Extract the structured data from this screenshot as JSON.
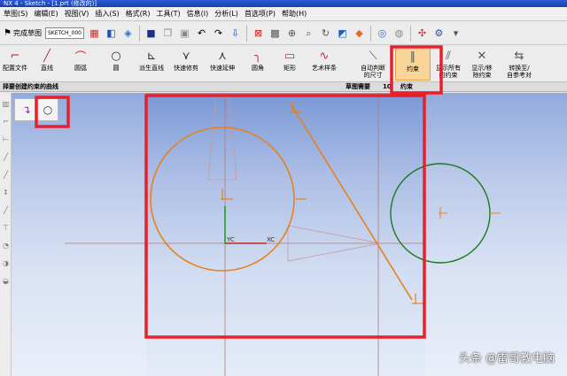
{
  "titlebar": {
    "text": "NX 4 - Sketch - [1.prt (修改的)]"
  },
  "menu": [
    "草图(S)",
    "编辑(E)",
    "视图(V)",
    "插入(S)",
    "格式(R)",
    "工具(T)",
    "信息(I)",
    "分析(L)",
    "首选项(P)",
    "帮助(H)"
  ],
  "toolbar1": {
    "finish_label": "完成草图",
    "sketch_name": "SKETCH_000"
  },
  "toolbar2": {
    "buttons": [
      {
        "label": "配置文件",
        "icon": "profile-icon"
      },
      {
        "label": "直线",
        "icon": "line-icon"
      },
      {
        "label": "圆弧",
        "icon": "arc-icon"
      },
      {
        "label": "圆",
        "icon": "circle-icon"
      },
      {
        "label": "派生直线",
        "icon": "derived-line-icon"
      },
      {
        "label": "快速修剪",
        "icon": "quick-trim-icon"
      },
      {
        "label": "快速延伸",
        "icon": "quick-extend-icon"
      },
      {
        "label": "圆角",
        "icon": "fillet-icon"
      },
      {
        "label": "矩形",
        "icon": "rectangle-icon"
      },
      {
        "label": "艺术样条",
        "icon": "spline-icon"
      },
      {
        "label": "自动判断\n的尺寸",
        "icon": "inferred-dimension-icon"
      },
      {
        "label": "约束",
        "icon": "constraints-icon"
      },
      {
        "label": "显示所有\n的约束",
        "icon": "show-constraints-icon"
      },
      {
        "label": "显示/移\n除约束",
        "icon": "show-remove-constraints-icon"
      },
      {
        "label": "转换至/\n自参考对",
        "icon": "convert-reference-icon"
      }
    ]
  },
  "status": {
    "prompt": "择要创建约束的曲线",
    "needs_label": "草图需要",
    "needs_value": "10",
    "right_label": "约束"
  },
  "canvas": {
    "xc_label": "XC",
    "yc_label": "YC"
  },
  "watermark": "头条 @雷哥教电脑",
  "colors": {
    "sketch_orange": "#e8801c",
    "green_circle": "#1c7a1c",
    "highlight_red": "#e8202c",
    "constraints_bg": "#f9d59a"
  }
}
